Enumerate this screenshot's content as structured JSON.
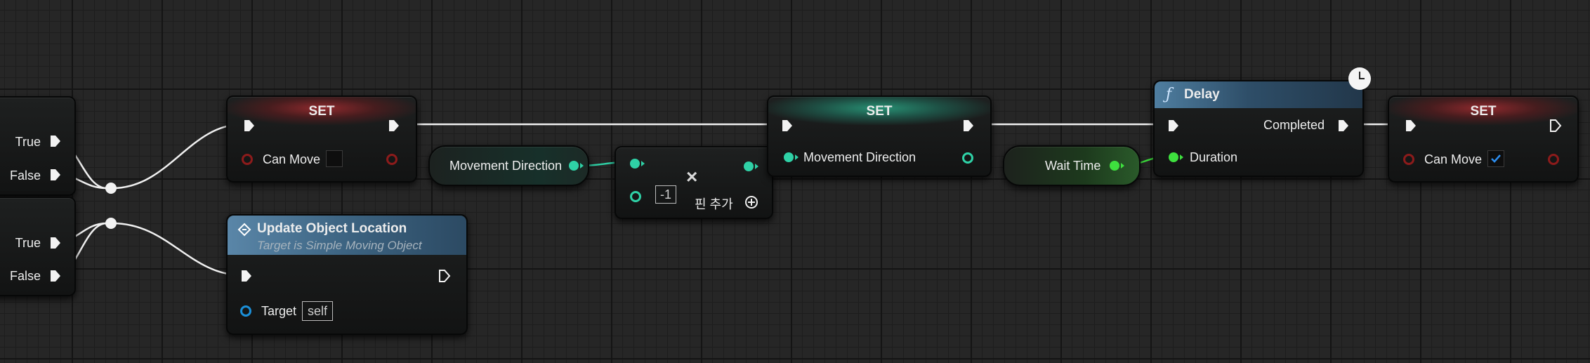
{
  "branch_nodes": [
    {
      "true_label": "True",
      "false_label": "False"
    },
    {
      "true_label": "True",
      "false_label": "False"
    }
  ],
  "set_can_move_1": {
    "title": "SET",
    "var_label": "Can Move",
    "checked": false
  },
  "update_location": {
    "title": "Update Object Location",
    "subtitle": "Target is Simple Moving Object",
    "target_label": "Target",
    "target_value": "self"
  },
  "get_direction": {
    "label": "Movement Direction"
  },
  "multiply": {
    "constant": "-1",
    "add_pin_label": "핀 추가"
  },
  "set_direction": {
    "title": "SET",
    "var_label": "Movement Direction"
  },
  "get_wait_time": {
    "label": "Wait Time"
  },
  "delay": {
    "title": "Delay",
    "icon": "function-icon",
    "completed_label": "Completed",
    "duration_label": "Duration"
  },
  "set_can_move_2": {
    "title": "SET",
    "var_label": "Can Move",
    "checked": true
  },
  "colors": {
    "exec": "#f2f2f2",
    "bool": "#8c1b1b",
    "vector": "#2fd1a6",
    "float": "#3ee03e",
    "object": "#1b8fd8",
    "checkbox_check": "#2d8ef0"
  }
}
